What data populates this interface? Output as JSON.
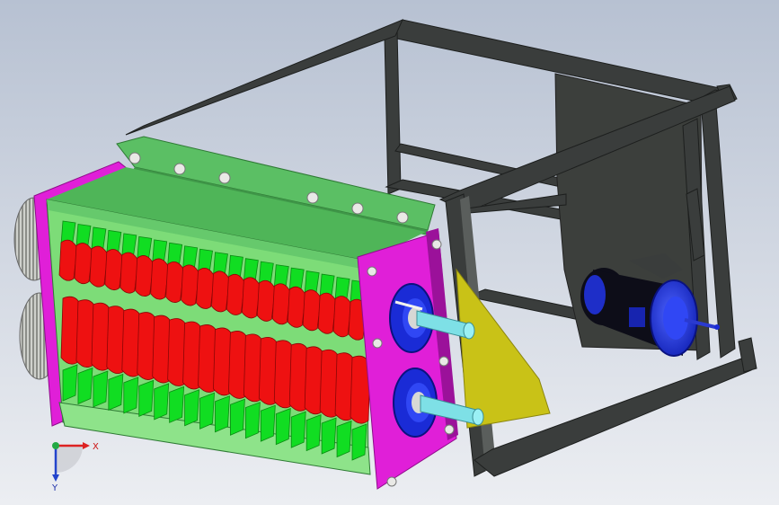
{
  "viewport": {
    "background_top": "#b7c1d2",
    "background_bottom": "#eceef2"
  },
  "model": {
    "frame_color": "#3a3d3c",
    "frame_highlight": "#5a5e5c",
    "housing_top_color": "#5bbf64",
    "housing_side_color": "#7ddc78",
    "endplate_color": "#e01fd8",
    "blade_color": "#ee1111",
    "tooth_color": "#11dd22",
    "bearing_color": "#1a2bd6",
    "shaft_color": "#7ee0e6",
    "gusset_color": "#c9c217",
    "panel_color": "#3c3f3c",
    "motor_body_color": "#0d0d18",
    "motor_cap_color": "#2033ee",
    "gear_color": "#c8cac5",
    "bolt_color": "#e9e9e6"
  },
  "triad": {
    "x_label": "X",
    "y_label": "Y",
    "x_color": "#dd2222",
    "y_color": "#2244cc",
    "origin_color": "#22aa44"
  }
}
